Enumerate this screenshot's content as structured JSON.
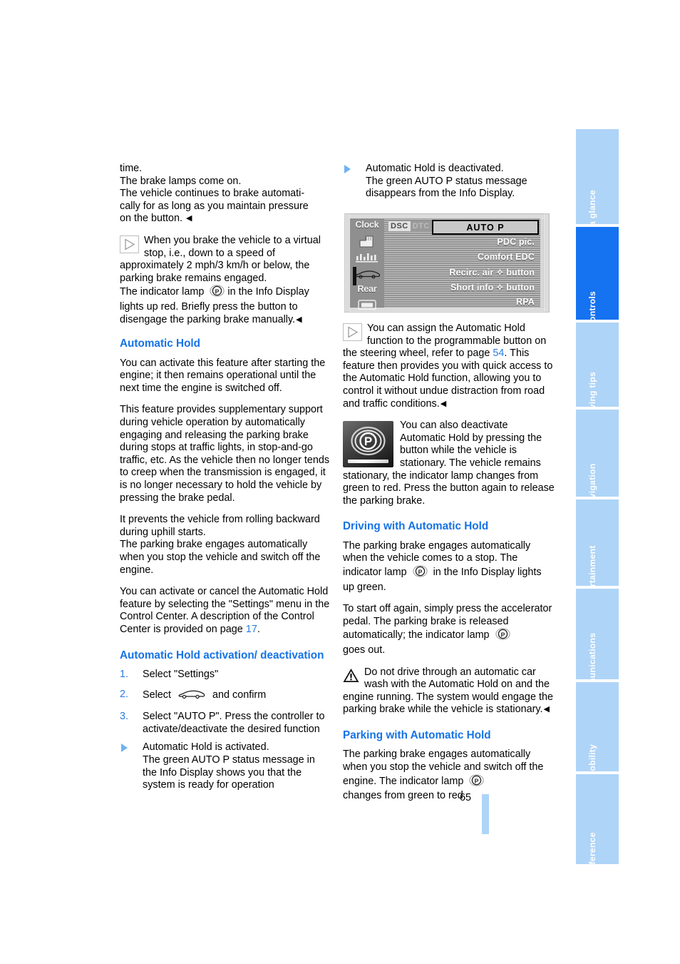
{
  "page": {
    "number": "65",
    "active_section": "Controls"
  },
  "rail": {
    "tabs": [
      {
        "label": "At a glance",
        "active": false
      },
      {
        "label": "Controls",
        "active": true
      },
      {
        "label": "Driving tips",
        "active": false
      },
      {
        "label": "Navigation",
        "active": false
      },
      {
        "label": "Entertainment",
        "active": false
      },
      {
        "label": "Communications",
        "active": false
      },
      {
        "label": "Mobility",
        "active": false
      },
      {
        "label": "Reference",
        "active": false
      }
    ]
  },
  "left_column": {
    "intro_paragraph": "time.\nThe brake lamps come on.\nThe vehicle continues to brake automatically for as long as you maintain pressure on the button.",
    "intro_lines": [
      "time.",
      "The brake lamps come on.",
      "The vehicle continues to brake automati-",
      "cally for as long as you maintain pressure",
      "on the button."
    ],
    "note_1": "When you brake the vehicle to a virtual stop, i.e., down to a speed of approximately 2 mph/3 km/h or below, the parking brake remains engaged.",
    "note_1_tail_a": "The indicator lamp",
    "note_1_tail_b": "in the Info Display lights up red. Briefly press the button to disengage the parking brake manually.",
    "heading_automatic_hold": "Automatic Hold",
    "para_1": "You can activate this feature after starting the engine; it then remains operational until the next time the engine is switched off.",
    "para_2": "This feature provides supplementary support during vehicle operation by automatically engaging and releasing the parking brake during stops at traffic lights, in stop-and-go traffic, etc. As the vehicle then no longer tends to creep when the transmission is engaged, it is no longer necessary to hold the vehicle by pressing the brake pedal.",
    "para_3": "It prevents the vehicle from rolling backward during uphill starts.\nThe parking brake engages automatically when you stop the vehicle and switch off the engine.",
    "para_4_a": "You can activate or cancel the Automatic Hold feature by selecting the \"Settings\" menu in the Control Center. A description of the Control Center is provided on page ",
    "para_4_page_ref": "17",
    "para_4_b": ".",
    "heading_activation": "Automatic Hold activation/ deactivation",
    "steps": [
      {
        "num": "1.",
        "text": "Select \"Settings\""
      },
      {
        "num": "2.",
        "text_before": "Select",
        "icon": "car-icon",
        "text_after": "and confirm"
      },
      {
        "num": "3.",
        "text": "Select \"AUTO P\". Press the controller to activate/deactivate the desired function"
      }
    ],
    "result_item": "Automatic Hold is activated.\nThe green AUTO P status message in the Info Display shows you that the system is ready for operation"
  },
  "right_column": {
    "result_item": "Automatic Hold is deactivated.\nThe green AUTO P status message disappears from the Info Display.",
    "note_2_a": "You can assign the Automatic Hold function to the programmable button on the steering wheel, refer to page ",
    "note_2_page_ref": "54",
    "note_2_b": ". This feature then provides you with quick access to the Automatic Hold function, allowing you to control it without undue distraction from road and traffic conditions.",
    "button_block": "You can also deactivate Automatic Hold by pressing the button while the vehicle is stationary. The vehicle remains stationary, the indicator lamp changes from green to red. Press the button again to release the parking brake.",
    "heading_driving": "Driving with Automatic Hold",
    "driving_a": "The parking brake engages automatically when the vehicle comes to a stop. The indicator lamp",
    "driving_b": "in the Info Display lights up green.",
    "driving_c": "To start off again, simply press the accelerator pedal. The parking brake is released automatically; the indicator lamp",
    "driving_d": "goes out.",
    "warning": "Do not drive through an automatic car wash with the Automatic Hold on and the engine running. The system would engage the parking brake while the vehicle is stationary.",
    "heading_parking": "Parking with Automatic Hold",
    "parking_a": "The parking brake engages automatically when you stop the vehicle and switch off the engine. The indicator lamp",
    "parking_b": "changes from green to red."
  },
  "info_display": {
    "caption": "",
    "left_items": [
      {
        "label": "Clock",
        "type": "text"
      },
      {
        "label": "",
        "type": "icon",
        "icon": "seat-icon"
      },
      {
        "label": "",
        "type": "icon",
        "icon": "equalizer-icon"
      },
      {
        "label": "",
        "type": "icon",
        "icon": "car-icon"
      },
      {
        "label": "Rear",
        "type": "text"
      },
      {
        "label": "",
        "type": "icon",
        "icon": "rear-window-icon"
      }
    ],
    "badges": {
      "dsc": "DSC",
      "dtc": "DTC"
    },
    "menu_rows": [
      {
        "label": "AUTO  P",
        "selected": true
      },
      {
        "label": "PDC pic.",
        "selected": false
      },
      {
        "label": "Comfort EDC",
        "selected": false
      },
      {
        "label": "Recirc. air ✧ button",
        "selected": false
      },
      {
        "label": "Short info ✧ button",
        "selected": false
      },
      {
        "label": "RPA",
        "selected": false
      }
    ]
  },
  "colors": {
    "heading_blue": "#1573e6",
    "link_blue": "#2a7de1",
    "tab_inactive": "#aed4f7",
    "tab_active": "#1572f0"
  }
}
